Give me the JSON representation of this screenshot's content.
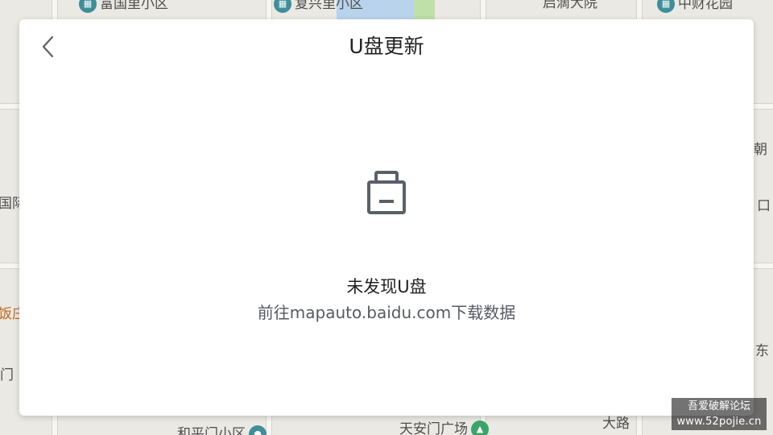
{
  "dialog": {
    "title": "U盘更新",
    "back_icon": "chevron-left-icon",
    "usb_icon": "usb-drive-icon",
    "status_title": "未发现U盘",
    "status_hint": "前往mapauto.baidu.com下载数据"
  },
  "map": {
    "labels": {
      "top_left": "富国里小区",
      "top_mid": "复兴里小区",
      "top_right_1": "启滴大院",
      "top_right_2": "中财花园",
      "left_1": "国际",
      "left_2": "饭庄",
      "left_3": "门",
      "right_1": "朝",
      "right_2": "口",
      "right_3": "东",
      "bottom_1": "和平门小区",
      "bottom_2": "天安门广场",
      "bottom_3": "大路"
    }
  },
  "watermark": {
    "line1": "吾爱破解论坛",
    "line2": "www.52pojie.cn"
  },
  "colors": {
    "dialog_bg": "#ffffff",
    "map_bg": "#ebe9e4",
    "icon_gray": "#5a6068",
    "title_text": "#222222",
    "hint_text": "#555b63"
  }
}
